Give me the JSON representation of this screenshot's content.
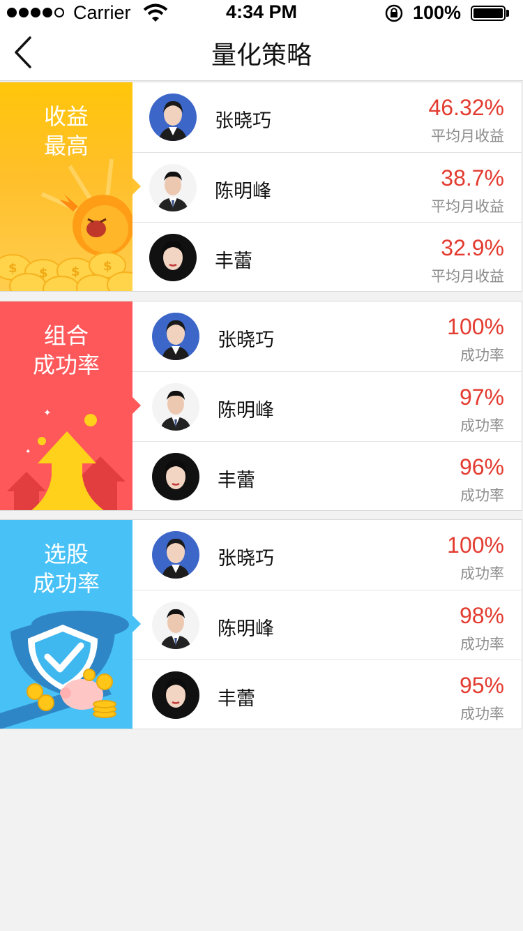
{
  "status_bar": {
    "carrier": "Carrier",
    "time": "4:34 PM",
    "battery": "100%"
  },
  "nav": {
    "title": "量化策略",
    "back_icon": "chevron-left-icon"
  },
  "colors": {
    "accent_red": "#e33b30",
    "banner_yellow": "#ffc42f",
    "banner_red": "#fe585b",
    "banner_blue": "#47c1f6"
  },
  "sections": [
    {
      "title_line1": "收益",
      "title_line2": "最高",
      "illustration": "sun-coins-illustration",
      "rows": [
        {
          "name": "张晓巧",
          "value": "46.32%",
          "label": "平均月收益",
          "avatar": "female-avatar"
        },
        {
          "name": "陈明峰",
          "value": "38.7%",
          "label": "平均月收益",
          "avatar": "male-avatar"
        },
        {
          "name": "丰蕾",
          "value": "32.9%",
          "label": "平均月收益",
          "avatar": "female-avatar"
        }
      ]
    },
    {
      "title_line1": "组合",
      "title_line2": "成功率",
      "illustration": "rising-arrows-illustration",
      "rows": [
        {
          "name": "张晓巧",
          "value": "100%",
          "label": "成功率",
          "avatar": "female-avatar"
        },
        {
          "name": "陈明峰",
          "value": "97%",
          "label": "成功率",
          "avatar": "male-avatar"
        },
        {
          "name": "丰蕾",
          "value": "96%",
          "label": "成功率",
          "avatar": "female-avatar"
        }
      ]
    },
    {
      "title_line1": "选股",
      "title_line2": "成功率",
      "illustration": "shield-piggy-bank-illustration",
      "rows": [
        {
          "name": "张晓巧",
          "value": "100%",
          "label": "成功率",
          "avatar": "female-avatar"
        },
        {
          "name": "陈明峰",
          "value": "98%",
          "label": "成功率",
          "avatar": "male-avatar"
        },
        {
          "name": "丰蕾",
          "value": "95%",
          "label": "成功率",
          "avatar": "female-avatar"
        }
      ]
    }
  ]
}
